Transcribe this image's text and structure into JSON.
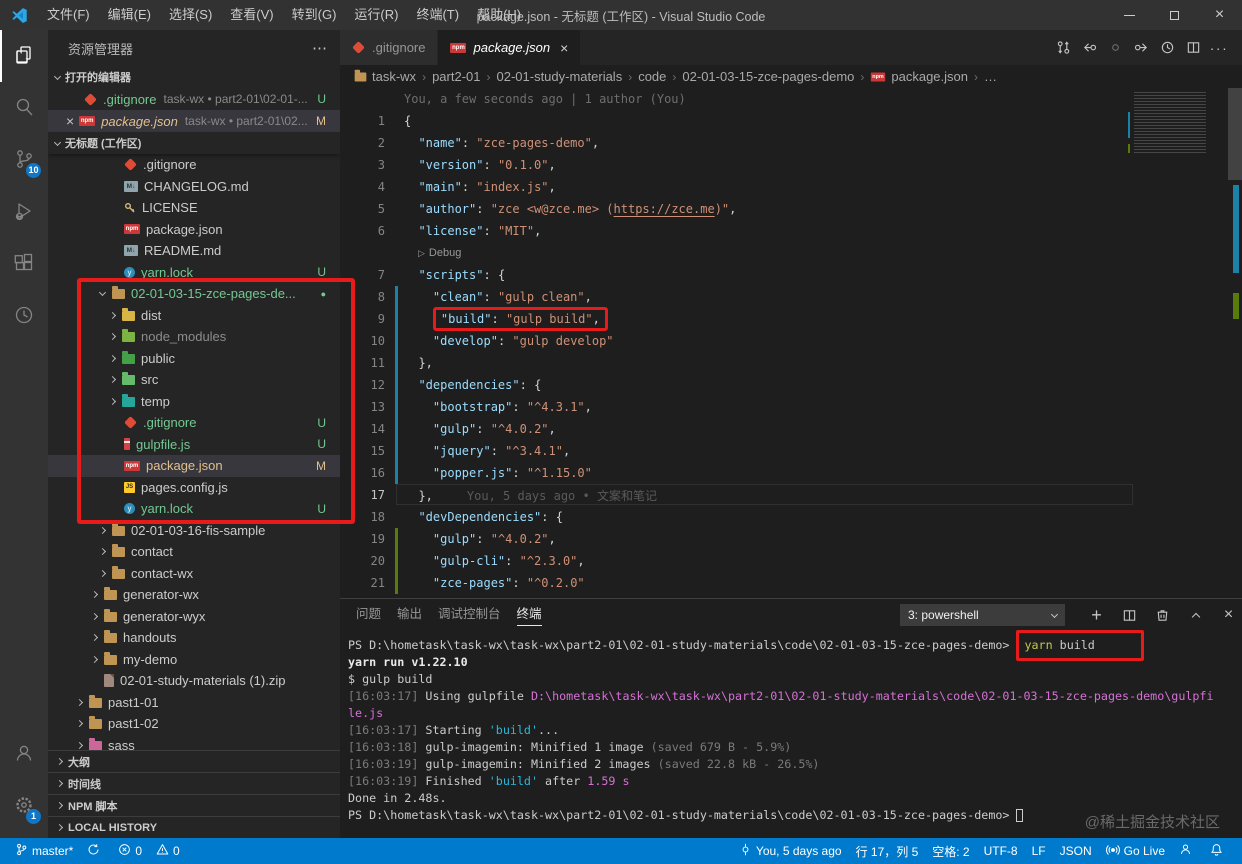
{
  "colors": {
    "accent": "#007acc",
    "annotation_red": "#e81b1b",
    "git_added_green": "#73c991",
    "git_modified_orange": "#e2c08d",
    "gutter_modified": "#1b81a8",
    "gutter_added": "#587c0c"
  },
  "window": {
    "title": "package.json - 无标题 (工作区) - Visual Studio Code",
    "controls": [
      "minimize",
      "maximize",
      "close"
    ]
  },
  "menu": [
    "文件(F)",
    "编辑(E)",
    "选择(S)",
    "查看(V)",
    "转到(G)",
    "运行(R)",
    "终端(T)",
    "帮助(H)"
  ],
  "activity_bar": {
    "top": [
      {
        "name": "explorer",
        "active": true
      },
      {
        "name": "search"
      },
      {
        "name": "source-control",
        "badge": "10"
      },
      {
        "name": "run-debug"
      },
      {
        "name": "extensions"
      },
      {
        "name": "gitlens"
      }
    ],
    "bottom": [
      {
        "name": "account"
      },
      {
        "name": "settings",
        "badge": "1"
      }
    ]
  },
  "sidebar": {
    "title": "资源管理器",
    "more_actions": "⋯",
    "open_editors": {
      "header": "打开的编辑器",
      "items": [
        {
          "label": ".gitignore",
          "icon": "git",
          "desc": "task-wx • part2-01\\02-01-...",
          "badge": "U",
          "color": "green"
        },
        {
          "label": "package.json",
          "icon": "npm",
          "desc": "task-wx • part2-01\\02...",
          "badge": "M",
          "color": "orange",
          "selected": true,
          "close": true,
          "italic": true
        }
      ]
    },
    "workspace": {
      "header": "无标题 (工作区)",
      "items": [
        {
          "label": ".gitignore",
          "icon": "git",
          "pad": 76
        },
        {
          "label": "CHANGELOG.md",
          "icon": "md",
          "pad": 76
        },
        {
          "label": "LICENSE",
          "icon": "key",
          "pad": 76
        },
        {
          "label": "package.json",
          "icon": "npm",
          "pad": 76
        },
        {
          "label": "README.md",
          "icon": "md",
          "pad": 76
        },
        {
          "label": "yarn.lock",
          "icon": "yarn",
          "pad": 76,
          "color": "green",
          "badge": "U"
        },
        {
          "label": "02-01-03-15-zce-pages-de...",
          "icon": "folder",
          "pad": 52,
          "chev": "open",
          "color": "green",
          "badge": "●"
        },
        {
          "label": "dist",
          "icon": "folder-dist",
          "pad": 62,
          "chev": "closed"
        },
        {
          "label": "node_modules",
          "icon": "folder-npm",
          "pad": 62,
          "chev": "closed",
          "color": "dim"
        },
        {
          "label": "public",
          "icon": "folder-public",
          "pad": 62,
          "chev": "closed"
        },
        {
          "label": "src",
          "icon": "folder-src",
          "pad": 62,
          "chev": "closed"
        },
        {
          "label": "temp",
          "icon": "folder-temp",
          "pad": 62,
          "chev": "closed"
        },
        {
          "label": ".gitignore",
          "icon": "git",
          "pad": 76,
          "color": "green",
          "badge": "U"
        },
        {
          "label": "gulpfile.js",
          "icon": "gulp",
          "pad": 76,
          "color": "green",
          "badge": "U"
        },
        {
          "label": "package.json",
          "icon": "npm",
          "pad": 76,
          "color": "orange",
          "badge": "M",
          "selected": true
        },
        {
          "label": "pages.config.js",
          "icon": "js",
          "pad": 76
        },
        {
          "label": "yarn.lock",
          "icon": "yarn",
          "pad": 76,
          "color": "green",
          "badge": "U"
        },
        {
          "label": "02-01-03-16-fis-sample",
          "icon": "folder",
          "pad": 52,
          "chev": "closed"
        },
        {
          "label": "contact",
          "icon": "folder",
          "pad": 52,
          "chev": "closed"
        },
        {
          "label": "contact-wx",
          "icon": "folder",
          "pad": 52,
          "chev": "closed"
        },
        {
          "label": "generator-wx",
          "icon": "folder",
          "pad": 44,
          "chev": "closed"
        },
        {
          "label": "generator-wyx",
          "icon": "folder",
          "pad": 44,
          "chev": "closed"
        },
        {
          "label": "handouts",
          "icon": "folder",
          "pad": 44,
          "chev": "closed"
        },
        {
          "label": "my-demo",
          "icon": "folder",
          "pad": 44,
          "chev": "closed"
        },
        {
          "label": "02-01-study-materials (1).zip",
          "icon": "zip",
          "pad": 56
        },
        {
          "label": "past1-01",
          "icon": "folder",
          "pad": 29,
          "chev": "closed"
        },
        {
          "label": "past1-02",
          "icon": "folder",
          "pad": 29,
          "chev": "closed"
        },
        {
          "label": "sass",
          "icon": "folder-sass",
          "pad": 29,
          "chev": "closed"
        }
      ]
    },
    "bottom_sections": [
      "大纲",
      "时间线",
      "NPM 脚本",
      "LOCAL HISTORY"
    ]
  },
  "tabs": [
    {
      "label": ".gitignore",
      "icon": "git",
      "active": false
    },
    {
      "label": "package.json",
      "icon": "npm",
      "active": true,
      "italic": true,
      "close": "×"
    }
  ],
  "tab_actions": [
    "git-compare",
    "previous-change",
    "open-changes",
    "next-change",
    "file-history",
    "split-editor",
    "more-actions"
  ],
  "breadcrumb": [
    {
      "label": "task-wx",
      "icon": "folder"
    },
    {
      "label": "part2-01"
    },
    {
      "label": "02-01-study-materials"
    },
    {
      "label": "code"
    },
    {
      "label": "02-01-03-15-zce-pages-demo"
    },
    {
      "label": "package.json",
      "icon": "npm"
    },
    {
      "label": "…"
    }
  ],
  "editor": {
    "blame_top": "You, a few seconds ago | 1 author (You)",
    "lines": [
      {
        "n": 1,
        "seg": [
          [
            "{",
            "p"
          ]
        ]
      },
      {
        "n": 2,
        "seg": [
          [
            "  ",
            "p"
          ],
          [
            "\"name\"",
            "k"
          ],
          [
            ": ",
            "p"
          ],
          [
            "\"zce-pages-demo\"",
            "s"
          ],
          [
            ",",
            "p"
          ]
        ]
      },
      {
        "n": 3,
        "seg": [
          [
            "  ",
            "p"
          ],
          [
            "\"version\"",
            "k"
          ],
          [
            ": ",
            "p"
          ],
          [
            "\"0.1.0\"",
            "s"
          ],
          [
            ",",
            "p"
          ]
        ]
      },
      {
        "n": 4,
        "seg": [
          [
            "  ",
            "p"
          ],
          [
            "\"main\"",
            "k"
          ],
          [
            ": ",
            "p"
          ],
          [
            "\"index.js\"",
            "s"
          ],
          [
            ",",
            "p"
          ]
        ]
      },
      {
        "n": 5,
        "seg": [
          [
            "  ",
            "p"
          ],
          [
            "\"author\"",
            "k"
          ],
          [
            ": ",
            "p"
          ],
          [
            "\"zce <w@zce.me> (",
            "s"
          ],
          [
            "https://zce.me",
            "su"
          ],
          [
            ")\"",
            "s"
          ],
          [
            ",",
            "p"
          ]
        ]
      },
      {
        "n": 6,
        "seg": [
          [
            "  ",
            "p"
          ],
          [
            "\"license\"",
            "k"
          ],
          [
            ": ",
            "p"
          ],
          [
            "\"MIT\"",
            "s"
          ],
          [
            ",",
            "p"
          ]
        ]
      },
      {
        "codelens": "Debug"
      },
      {
        "n": 7,
        "seg": [
          [
            "  ",
            "p"
          ],
          [
            "\"scripts\"",
            "k"
          ],
          [
            ": ",
            "p"
          ],
          [
            "{",
            "p"
          ]
        ]
      },
      {
        "n": 8,
        "g": "mod",
        "seg": [
          [
            "    ",
            "p"
          ],
          [
            "\"clean\"",
            "k"
          ],
          [
            ": ",
            "p"
          ],
          [
            "\"gulp clean\"",
            "s"
          ],
          [
            ",",
            "p"
          ]
        ]
      },
      {
        "n": 9,
        "g": "mod",
        "box": true,
        "seg": [
          [
            "    ",
            "p"
          ],
          [
            "\"build\"",
            "k"
          ],
          [
            ": ",
            "p"
          ],
          [
            "\"gulp build\"",
            "s"
          ],
          [
            ",",
            "p"
          ]
        ]
      },
      {
        "n": 10,
        "g": "mod",
        "seg": [
          [
            "    ",
            "p"
          ],
          [
            "\"develop\"",
            "k"
          ],
          [
            ": ",
            "p"
          ],
          [
            "\"gulp develop\"",
            "s"
          ]
        ]
      },
      {
        "n": 11,
        "g": "mod",
        "seg": [
          [
            "  ",
            "p"
          ],
          [
            "},",
            "p"
          ]
        ]
      },
      {
        "n": 12,
        "g": "mod",
        "seg": [
          [
            "  ",
            "p"
          ],
          [
            "\"dependencies\"",
            "k"
          ],
          [
            ": ",
            "p"
          ],
          [
            "{",
            "p"
          ]
        ]
      },
      {
        "n": 13,
        "g": "mod",
        "seg": [
          [
            "    ",
            "p"
          ],
          [
            "\"bootstrap\"",
            "k"
          ],
          [
            ": ",
            "p"
          ],
          [
            "\"^4.3.1\"",
            "s"
          ],
          [
            ",",
            "p"
          ]
        ]
      },
      {
        "n": 14,
        "g": "mod",
        "seg": [
          [
            "    ",
            "p"
          ],
          [
            "\"gulp\"",
            "k"
          ],
          [
            ": ",
            "p"
          ],
          [
            "\"^4.0.2\"",
            "s"
          ],
          [
            ",",
            "p"
          ]
        ]
      },
      {
        "n": 15,
        "g": "mod",
        "seg": [
          [
            "    ",
            "p"
          ],
          [
            "\"jquery\"",
            "k"
          ],
          [
            ": ",
            "p"
          ],
          [
            "\"^3.4.1\"",
            "s"
          ],
          [
            ",",
            "p"
          ]
        ]
      },
      {
        "n": 16,
        "g": "mod",
        "seg": [
          [
            "    ",
            "p"
          ],
          [
            "\"popper.js\"",
            "k"
          ],
          [
            ": ",
            "p"
          ],
          [
            "\"^1.15.0\"",
            "s"
          ]
        ]
      },
      {
        "n": 17,
        "current": true,
        "blame": "You, 5 days ago • 文案和笔记",
        "seg": [
          [
            "  ",
            "p"
          ],
          [
            "},",
            "p"
          ]
        ]
      },
      {
        "n": 18,
        "seg": [
          [
            "  ",
            "p"
          ],
          [
            "\"devDependencies\"",
            "k"
          ],
          [
            ": ",
            "p"
          ],
          [
            "{",
            "p"
          ]
        ]
      },
      {
        "n": 19,
        "g": "add",
        "seg": [
          [
            "    ",
            "p"
          ],
          [
            "\"gulp\"",
            "k"
          ],
          [
            ": ",
            "p"
          ],
          [
            "\"^4.0.2\"",
            "s"
          ],
          [
            ",",
            "p"
          ]
        ]
      },
      {
        "n": 20,
        "g": "add",
        "seg": [
          [
            "    ",
            "p"
          ],
          [
            "\"gulp-cli\"",
            "k"
          ],
          [
            ": ",
            "p"
          ],
          [
            "\"^2.3.0\"",
            "s"
          ],
          [
            ",",
            "p"
          ]
        ]
      },
      {
        "n": 21,
        "g": "add",
        "seg": [
          [
            "    ",
            "p"
          ],
          [
            "\"zce-pages\"",
            "k"
          ],
          [
            ": ",
            "p"
          ],
          [
            "\"^0.2.0\"",
            "s"
          ]
        ]
      }
    ]
  },
  "panel": {
    "tabs": [
      {
        "label": "问题"
      },
      {
        "label": "输出"
      },
      {
        "label": "调试控制台"
      },
      {
        "label": "终端",
        "active": true
      }
    ],
    "shell_selector": "3: powershell",
    "actions": [
      "new-terminal",
      "split-terminal",
      "kill-terminal",
      "maximize-panel",
      "close-panel"
    ],
    "terminal": [
      {
        "seg": [
          [
            "PS D:\\hometask\\task-wx\\task-wx\\part2-01\\02-01-study-materials\\code\\02-01-03-15-zce-pages-demo> ",
            "t"
          ],
          [
            "yarn",
            "yel"
          ],
          [
            " build",
            "t"
          ]
        ],
        "boxFrom": 1,
        "boxTo": 2
      },
      {
        "seg": [
          [
            "yarn run v1.22.10",
            "tbold"
          ]
        ]
      },
      {
        "seg": [
          [
            "$ gulp build",
            "t"
          ]
        ]
      },
      {
        "seg": [
          [
            "[16:03:17] ",
            "dim"
          ],
          [
            "Using gulpfile ",
            "t"
          ],
          [
            "D:\\hometask\\task-wx\\task-wx\\part2-01\\02-01-study-materials\\code\\02-01-03-15-zce-pages-demo\\gulpfi",
            "mag"
          ]
        ]
      },
      {
        "seg": [
          [
            "le.js",
            "mag"
          ]
        ]
      },
      {
        "seg": [
          [
            "[16:03:17] ",
            "dim"
          ],
          [
            "Starting ",
            "t"
          ],
          [
            "'build'",
            "cyan"
          ],
          [
            "...",
            "t"
          ]
        ]
      },
      {
        "seg": [
          [
            "[16:03:18] ",
            "dim"
          ],
          [
            "gulp-imagemin: Minified 1 image ",
            "t"
          ],
          [
            "(saved 679 B - 5.9%)",
            "dim"
          ]
        ]
      },
      {
        "seg": [
          [
            "[16:03:19] ",
            "dim"
          ],
          [
            "gulp-imagemin: Minified 2 images ",
            "t"
          ],
          [
            "(saved 22.8 kB - 26.5%)",
            "dim"
          ]
        ]
      },
      {
        "seg": [
          [
            "[16:03:19] ",
            "dim"
          ],
          [
            "Finished ",
            "t"
          ],
          [
            "'build'",
            "cyan"
          ],
          [
            " after ",
            "t"
          ],
          [
            "1.59 s",
            "mag"
          ]
        ]
      },
      {
        "seg": [
          [
            "Done in 2.48s.",
            "t"
          ]
        ]
      },
      {
        "seg": [
          [
            "PS D:\\hometask\\task-wx\\task-wx\\part2-01\\02-01-study-materials\\code\\02-01-03-15-zce-pages-demo> ",
            "t"
          ],
          [
            "",
            "cursor"
          ]
        ]
      }
    ],
    "watermark": "@稀土掘金技术社区"
  },
  "status_bar": {
    "left": [
      {
        "icon": "branch",
        "label": "master*",
        "name": "git-branch"
      },
      {
        "icon": "sync",
        "label": "",
        "name": "sync"
      },
      {
        "icon": "error",
        "label": "0",
        "name": "errors"
      },
      {
        "icon": "warning",
        "label": "0",
        "name": "warnings"
      }
    ],
    "right": [
      {
        "icon": "commit",
        "label": "You, 5 days ago",
        "name": "gitlens-blame"
      },
      {
        "label": "行 17，列 5",
        "name": "cursor-position"
      },
      {
        "label": "空格: 2",
        "name": "indentation"
      },
      {
        "label": "UTF-8",
        "name": "encoding"
      },
      {
        "label": "LF",
        "name": "eol"
      },
      {
        "label": "JSON",
        "name": "language-mode"
      },
      {
        "icon": "broadcast",
        "label": "Go Live",
        "name": "go-live"
      },
      {
        "icon": "person",
        "label": "",
        "name": "feedback"
      },
      {
        "icon": "bell",
        "label": "",
        "name": "notifications"
      }
    ]
  }
}
